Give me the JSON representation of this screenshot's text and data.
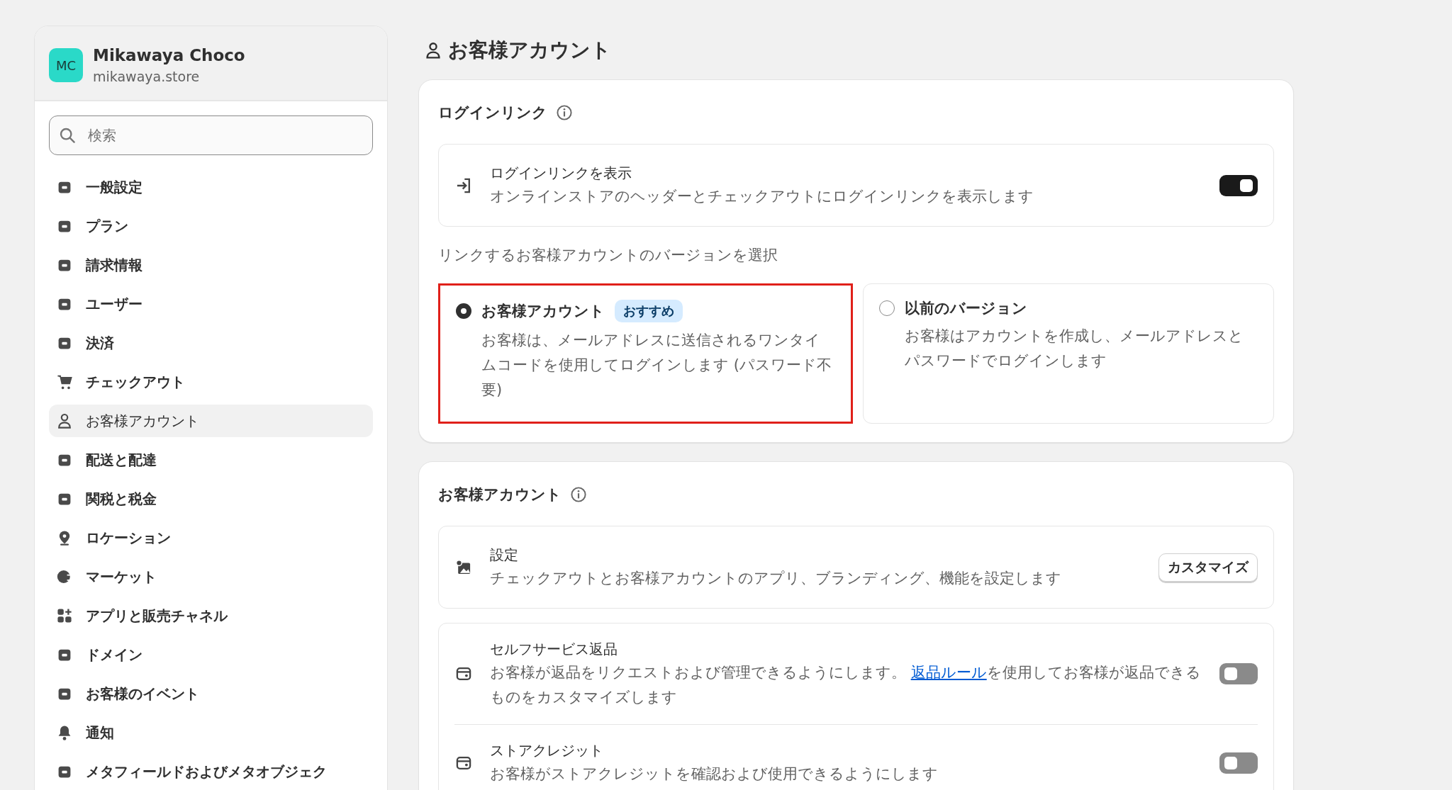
{
  "store": {
    "initials": "MC",
    "name": "Mikawaya Choco",
    "domain": "mikawaya.store"
  },
  "search": {
    "placeholder": "検索"
  },
  "nav": [
    {
      "label": "一般設定",
      "selected": false
    },
    {
      "label": "プラン",
      "selected": false
    },
    {
      "label": "請求情報",
      "selected": false
    },
    {
      "label": "ユーザー",
      "selected": false
    },
    {
      "label": "決済",
      "selected": false
    },
    {
      "label": "チェックアウト",
      "selected": false
    },
    {
      "label": "お客様アカウント",
      "selected": true
    },
    {
      "label": "配送と配達",
      "selected": false
    },
    {
      "label": "関税と税金",
      "selected": false
    },
    {
      "label": "ロケーション",
      "selected": false
    },
    {
      "label": "マーケット",
      "selected": false
    },
    {
      "label": "アプリと販売チャネル",
      "selected": false
    },
    {
      "label": "ドメイン",
      "selected": false
    },
    {
      "label": "お客様のイベント",
      "selected": false
    },
    {
      "label": "通知",
      "selected": false
    },
    {
      "label": "メタフィールドおよびメタオブジェク",
      "selected": false
    }
  ],
  "page_title": "お客様アカウント",
  "login_section": {
    "title": "ログインリンク",
    "setting": {
      "title": "ログインリンクを表示",
      "description": "オンラインストアのヘッダーとチェックアウトにログインリンクを表示します",
      "on": true
    },
    "version_label": "リンクするお客様アカウントのバージョンを選択",
    "options": [
      {
        "title": "お客様アカウント",
        "badge": "おすすめ",
        "description": "お客様は、メールアドレスに送信されるワンタイムコードを使用してログインします (パスワード不要)",
        "selected": true,
        "highlighted": true
      },
      {
        "title": "以前のバージョン",
        "description": "お客様はアカウントを作成し、メールアドレスとパスワードでログインします",
        "selected": false,
        "highlighted": false
      }
    ]
  },
  "accounts_section": {
    "title": "お客様アカウント",
    "settings": {
      "title": "設定",
      "description": "チェックアウトとお客様アカウントのアプリ、ブランディング、機能を設定します",
      "button": "カスタマイズ"
    },
    "features": [
      {
        "title": "セルフサービス返品",
        "description_before": "お客様が返品をリクエストおよび管理できるようにします。 ",
        "link": "返品ルール",
        "description_after": "を使用してお客様が返品できるものをカスタマイズします",
        "on": false
      },
      {
        "title": "ストアクレジット",
        "description_before": "お客様がストアクレジットを確認および使用できるようにします",
        "on": false
      }
    ]
  }
}
